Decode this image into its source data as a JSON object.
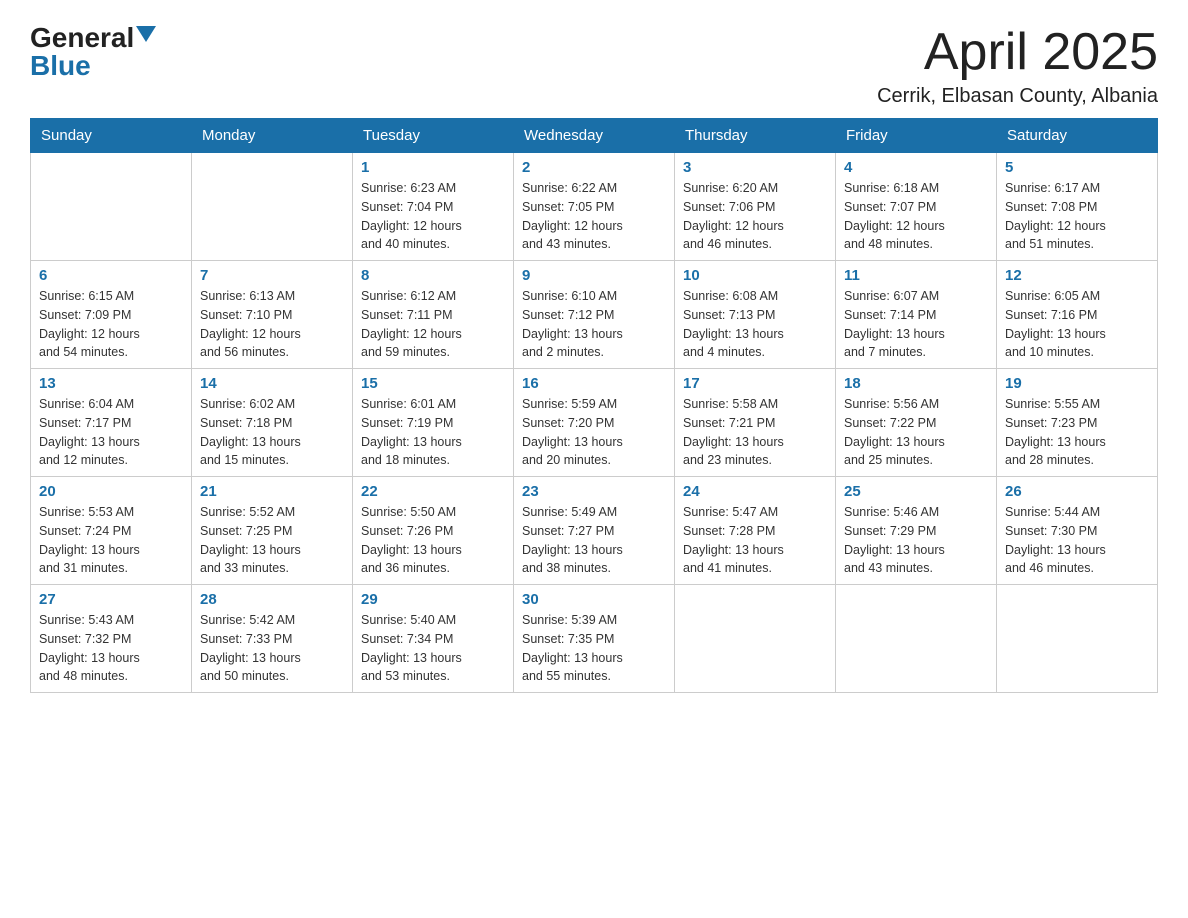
{
  "logo": {
    "general": "General",
    "blue": "Blue"
  },
  "title": "April 2025",
  "subtitle": "Cerrik, Elbasan County, Albania",
  "weekdays": [
    "Sunday",
    "Monday",
    "Tuesday",
    "Wednesday",
    "Thursday",
    "Friday",
    "Saturday"
  ],
  "weeks": [
    [
      {
        "day": "",
        "info": ""
      },
      {
        "day": "",
        "info": ""
      },
      {
        "day": "1",
        "info": "Sunrise: 6:23 AM\nSunset: 7:04 PM\nDaylight: 12 hours\nand 40 minutes."
      },
      {
        "day": "2",
        "info": "Sunrise: 6:22 AM\nSunset: 7:05 PM\nDaylight: 12 hours\nand 43 minutes."
      },
      {
        "day": "3",
        "info": "Sunrise: 6:20 AM\nSunset: 7:06 PM\nDaylight: 12 hours\nand 46 minutes."
      },
      {
        "day": "4",
        "info": "Sunrise: 6:18 AM\nSunset: 7:07 PM\nDaylight: 12 hours\nand 48 minutes."
      },
      {
        "day": "5",
        "info": "Sunrise: 6:17 AM\nSunset: 7:08 PM\nDaylight: 12 hours\nand 51 minutes."
      }
    ],
    [
      {
        "day": "6",
        "info": "Sunrise: 6:15 AM\nSunset: 7:09 PM\nDaylight: 12 hours\nand 54 minutes."
      },
      {
        "day": "7",
        "info": "Sunrise: 6:13 AM\nSunset: 7:10 PM\nDaylight: 12 hours\nand 56 minutes."
      },
      {
        "day": "8",
        "info": "Sunrise: 6:12 AM\nSunset: 7:11 PM\nDaylight: 12 hours\nand 59 minutes."
      },
      {
        "day": "9",
        "info": "Sunrise: 6:10 AM\nSunset: 7:12 PM\nDaylight: 13 hours\nand 2 minutes."
      },
      {
        "day": "10",
        "info": "Sunrise: 6:08 AM\nSunset: 7:13 PM\nDaylight: 13 hours\nand 4 minutes."
      },
      {
        "day": "11",
        "info": "Sunrise: 6:07 AM\nSunset: 7:14 PM\nDaylight: 13 hours\nand 7 minutes."
      },
      {
        "day": "12",
        "info": "Sunrise: 6:05 AM\nSunset: 7:16 PM\nDaylight: 13 hours\nand 10 minutes."
      }
    ],
    [
      {
        "day": "13",
        "info": "Sunrise: 6:04 AM\nSunset: 7:17 PM\nDaylight: 13 hours\nand 12 minutes."
      },
      {
        "day": "14",
        "info": "Sunrise: 6:02 AM\nSunset: 7:18 PM\nDaylight: 13 hours\nand 15 minutes."
      },
      {
        "day": "15",
        "info": "Sunrise: 6:01 AM\nSunset: 7:19 PM\nDaylight: 13 hours\nand 18 minutes."
      },
      {
        "day": "16",
        "info": "Sunrise: 5:59 AM\nSunset: 7:20 PM\nDaylight: 13 hours\nand 20 minutes."
      },
      {
        "day": "17",
        "info": "Sunrise: 5:58 AM\nSunset: 7:21 PM\nDaylight: 13 hours\nand 23 minutes."
      },
      {
        "day": "18",
        "info": "Sunrise: 5:56 AM\nSunset: 7:22 PM\nDaylight: 13 hours\nand 25 minutes."
      },
      {
        "day": "19",
        "info": "Sunrise: 5:55 AM\nSunset: 7:23 PM\nDaylight: 13 hours\nand 28 minutes."
      }
    ],
    [
      {
        "day": "20",
        "info": "Sunrise: 5:53 AM\nSunset: 7:24 PM\nDaylight: 13 hours\nand 31 minutes."
      },
      {
        "day": "21",
        "info": "Sunrise: 5:52 AM\nSunset: 7:25 PM\nDaylight: 13 hours\nand 33 minutes."
      },
      {
        "day": "22",
        "info": "Sunrise: 5:50 AM\nSunset: 7:26 PM\nDaylight: 13 hours\nand 36 minutes."
      },
      {
        "day": "23",
        "info": "Sunrise: 5:49 AM\nSunset: 7:27 PM\nDaylight: 13 hours\nand 38 minutes."
      },
      {
        "day": "24",
        "info": "Sunrise: 5:47 AM\nSunset: 7:28 PM\nDaylight: 13 hours\nand 41 minutes."
      },
      {
        "day": "25",
        "info": "Sunrise: 5:46 AM\nSunset: 7:29 PM\nDaylight: 13 hours\nand 43 minutes."
      },
      {
        "day": "26",
        "info": "Sunrise: 5:44 AM\nSunset: 7:30 PM\nDaylight: 13 hours\nand 46 minutes."
      }
    ],
    [
      {
        "day": "27",
        "info": "Sunrise: 5:43 AM\nSunset: 7:32 PM\nDaylight: 13 hours\nand 48 minutes."
      },
      {
        "day": "28",
        "info": "Sunrise: 5:42 AM\nSunset: 7:33 PM\nDaylight: 13 hours\nand 50 minutes."
      },
      {
        "day": "29",
        "info": "Sunrise: 5:40 AM\nSunset: 7:34 PM\nDaylight: 13 hours\nand 53 minutes."
      },
      {
        "day": "30",
        "info": "Sunrise: 5:39 AM\nSunset: 7:35 PM\nDaylight: 13 hours\nand 55 minutes."
      },
      {
        "day": "",
        "info": ""
      },
      {
        "day": "",
        "info": ""
      },
      {
        "day": "",
        "info": ""
      }
    ]
  ]
}
